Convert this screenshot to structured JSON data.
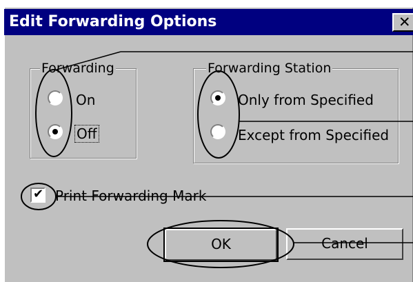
{
  "window": {
    "title": "Edit Forwarding Options",
    "close_glyph": "✕"
  },
  "forwarding": {
    "legend": "Forwarding",
    "on_label": "On",
    "off_label": "Off",
    "selected": "Off"
  },
  "station": {
    "legend": "Forwarding Station",
    "only_label": "Only from Specified",
    "except_label": "Except from Specified",
    "selected": "Only from Specified"
  },
  "print_mark": {
    "label": "Print Forwarding Mark",
    "checked": true
  },
  "buttons": {
    "ok": "OK",
    "cancel": "Cancel"
  },
  "icons": [
    "close-icon",
    "radio-selected-icon",
    "radio-unselected-icon",
    "checkbox-checked-icon"
  ],
  "colors": {
    "titlebar": "#000080",
    "dialog": "#c0c0c0"
  }
}
